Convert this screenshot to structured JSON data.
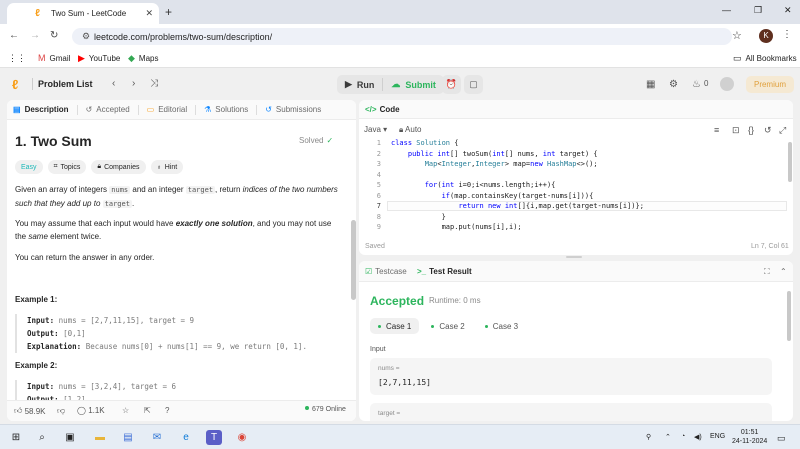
{
  "browser": {
    "tab_title": "Two Sum - LeetCode",
    "url": "leetcode.com/problems/two-sum/description/",
    "profile_initial": "K",
    "bookmarks": [
      "Gmail",
      "YouTube",
      "Maps"
    ],
    "all_bookmarks": "All Bookmarks"
  },
  "nav": {
    "problem_list": "Problem List",
    "run": "Run",
    "submit": "Submit",
    "streak": "0",
    "premium": "Premium"
  },
  "left_panel": {
    "tabs": [
      "Description",
      "Accepted",
      "Editorial",
      "Solutions",
      "Submissions"
    ],
    "title": "1. Two Sum",
    "status": "Solved",
    "chips": [
      "Easy",
      "Topics",
      "Companies",
      "Hint"
    ],
    "desc": {
      "p1_a": "Given an array of integers ",
      "p1_code1": "nums",
      "p1_b": " and an integer ",
      "p1_code2": "target",
      "p1_c": ", return ",
      "p1_em": "indices of the two numbers such that they add up to",
      "p1_code3": "target",
      "p1_end": ".",
      "p2_a": "You may assume that each input would have ",
      "p2_b": "exactly one solution",
      "p2_c": ", and you may not use the ",
      "p2_em": "same",
      "p2_d": " element twice.",
      "p3": "You can return the answer in any order."
    },
    "examples": [
      {
        "title": "Example 1:",
        "input_label": "Input:",
        "input": "nums = [2,7,11,15], target = 9",
        "output_label": "Output:",
        "output": "[0,1]",
        "explanation_label": "Explanation:",
        "explanation": "Because nums[0] + nums[1] == 9, we return [0, 1]."
      },
      {
        "title": "Example 2:",
        "input_label": "Input:",
        "input": "nums = [3,2,4], target = 6",
        "output_label": "Output:",
        "output": "[1,2]"
      }
    ],
    "footer": {
      "likes": "58.9K",
      "comments": "1.1K",
      "online": "679 Online"
    }
  },
  "code_panel": {
    "title": "Code",
    "language": "Java",
    "mode": "Auto",
    "lines": [
      {
        "n": "1",
        "text": "class Solution {"
      },
      {
        "n": "2",
        "text": "    public int[] twoSum(int[] nums, int target) {"
      },
      {
        "n": "3",
        "text": "        Map<Integer,Integer> map=new HashMap<>();"
      },
      {
        "n": "4",
        "text": ""
      },
      {
        "n": "5",
        "text": "        for(int i=0;i<nums.length;i++){"
      },
      {
        "n": "6",
        "text": "            if(map.containsKey(target-nums[i])){"
      },
      {
        "n": "7",
        "text": "                return new int[]{i,map.get(target-nums[i])};"
      },
      {
        "n": "8",
        "text": "            }"
      },
      {
        "n": "9",
        "text": "            map.put(nums[i],i);"
      }
    ],
    "saved": "Saved",
    "cursor": "Ln 7, Col 61"
  },
  "result_panel": {
    "tabs": [
      "Testcase",
      "Test Result"
    ],
    "status": "Accepted",
    "runtime": "Runtime: 0 ms",
    "cases": [
      "Case 1",
      "Case 2",
      "Case 3"
    ],
    "input_label": "Input",
    "inputs": [
      {
        "name": "nums =",
        "value": "[2,7,11,15]"
      },
      {
        "name": "target =",
        "value": ""
      }
    ]
  },
  "taskbar": {
    "lang": "ENG",
    "time": "01:51",
    "date": "24-11-2024"
  },
  "colors": {
    "accent_green": "#2db55d",
    "brand_orange": "#f89f1b",
    "easy": "#1cb8b8"
  }
}
